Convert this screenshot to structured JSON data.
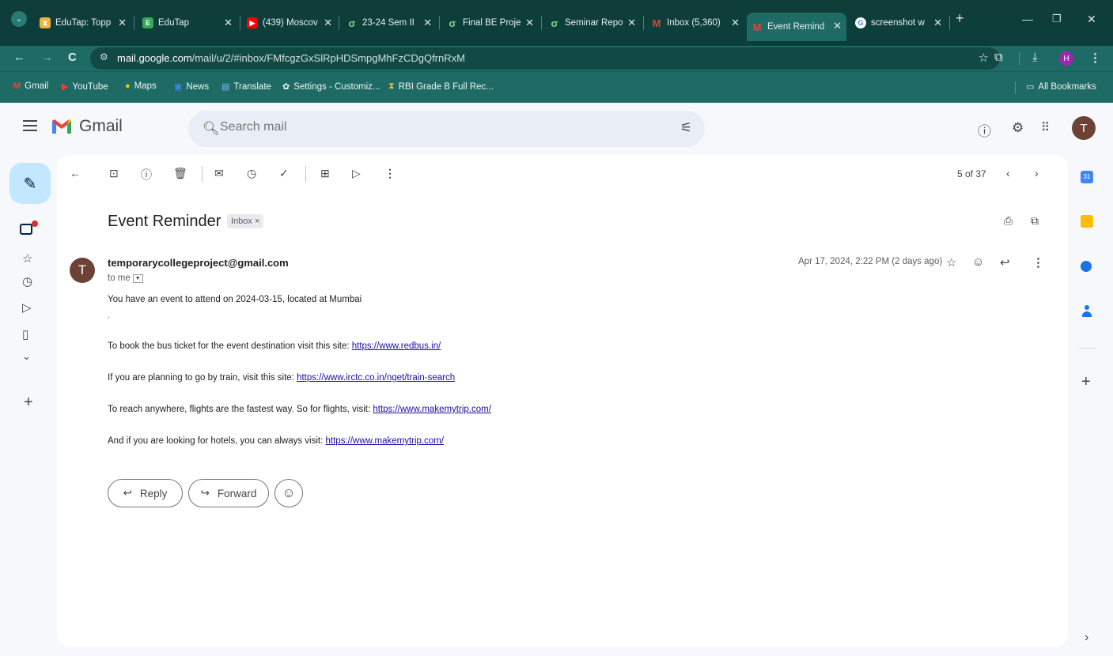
{
  "browser": {
    "tabs": [
      {
        "label": "EduTap: Topp",
        "icon": "edutap-icon",
        "color": "#f0b43a"
      },
      {
        "label": "EduTap",
        "icon": "edutap-doc-icon",
        "color": "#34a853"
      },
      {
        "label": "(439) Moscov",
        "icon": "youtube-icon",
        "color": "#ff0000"
      },
      {
        "label": "23-24 Sem II",
        "icon": "leaf-icon",
        "color": "#7bd389"
      },
      {
        "label": "Final BE Proje",
        "icon": "leaf-icon",
        "color": "#7bd389"
      },
      {
        "label": "Seminar Repo",
        "icon": "leaf-icon",
        "color": "#7bd389"
      },
      {
        "label": "Inbox (5,360)",
        "icon": "gmail-icon",
        "color": "#ea4335"
      },
      {
        "label": "Event Remind",
        "icon": "gmail-icon",
        "color": "#ea4335"
      },
      {
        "label": "screenshot w",
        "icon": "google-icon",
        "color": "#4285f4"
      }
    ],
    "url_host": "mail.google.com",
    "url_path": "/mail/u/2/#inbox/FMfcgzGxSlRpHDSmpgMhFzCDgQfrnRxM",
    "profile_letter": "H",
    "bookmarks": [
      "Gmail",
      "YouTube",
      "Maps",
      "News",
      "Translate",
      "Settings - Customiz...",
      "RBI Grade B Full Rec..."
    ],
    "all_bookmarks": "All Bookmarks"
  },
  "gmail": {
    "app_name": "Gmail",
    "search_placeholder": "Search mail",
    "account_letter": "T",
    "counter": "5 of 37",
    "subject": "Event Reminder",
    "label": "Inbox ×",
    "sender_email": "temporarycollegeproject@gmail.com",
    "sender_letter": "T",
    "to": "to me",
    "date": "Apr 17, 2024, 2:22 PM (2 days ago)",
    "body": {
      "line1": "You have an event to attend on 2024-03-15, located at Mumbai",
      "dot": ".",
      "bus_text": "To book the bus ticket for the event destination visit this site: ",
      "bus_link": "https://www.redbus.in/",
      "train_text": "If you are planning to go by train, visit this site: ",
      "train_link": "https://www.irctc.co.in/nget/train-search",
      "flight_text": "To reach anywhere, flights are the fastest way. So for flights, visit: ",
      "flight_link": "https://www.makemytrip.com/",
      "hotel_text": "And if you are looking for hotels, you can always visit: ",
      "hotel_link": "https://www.makemytrip.com/"
    },
    "reply_label": "Reply",
    "forward_label": "Forward"
  }
}
